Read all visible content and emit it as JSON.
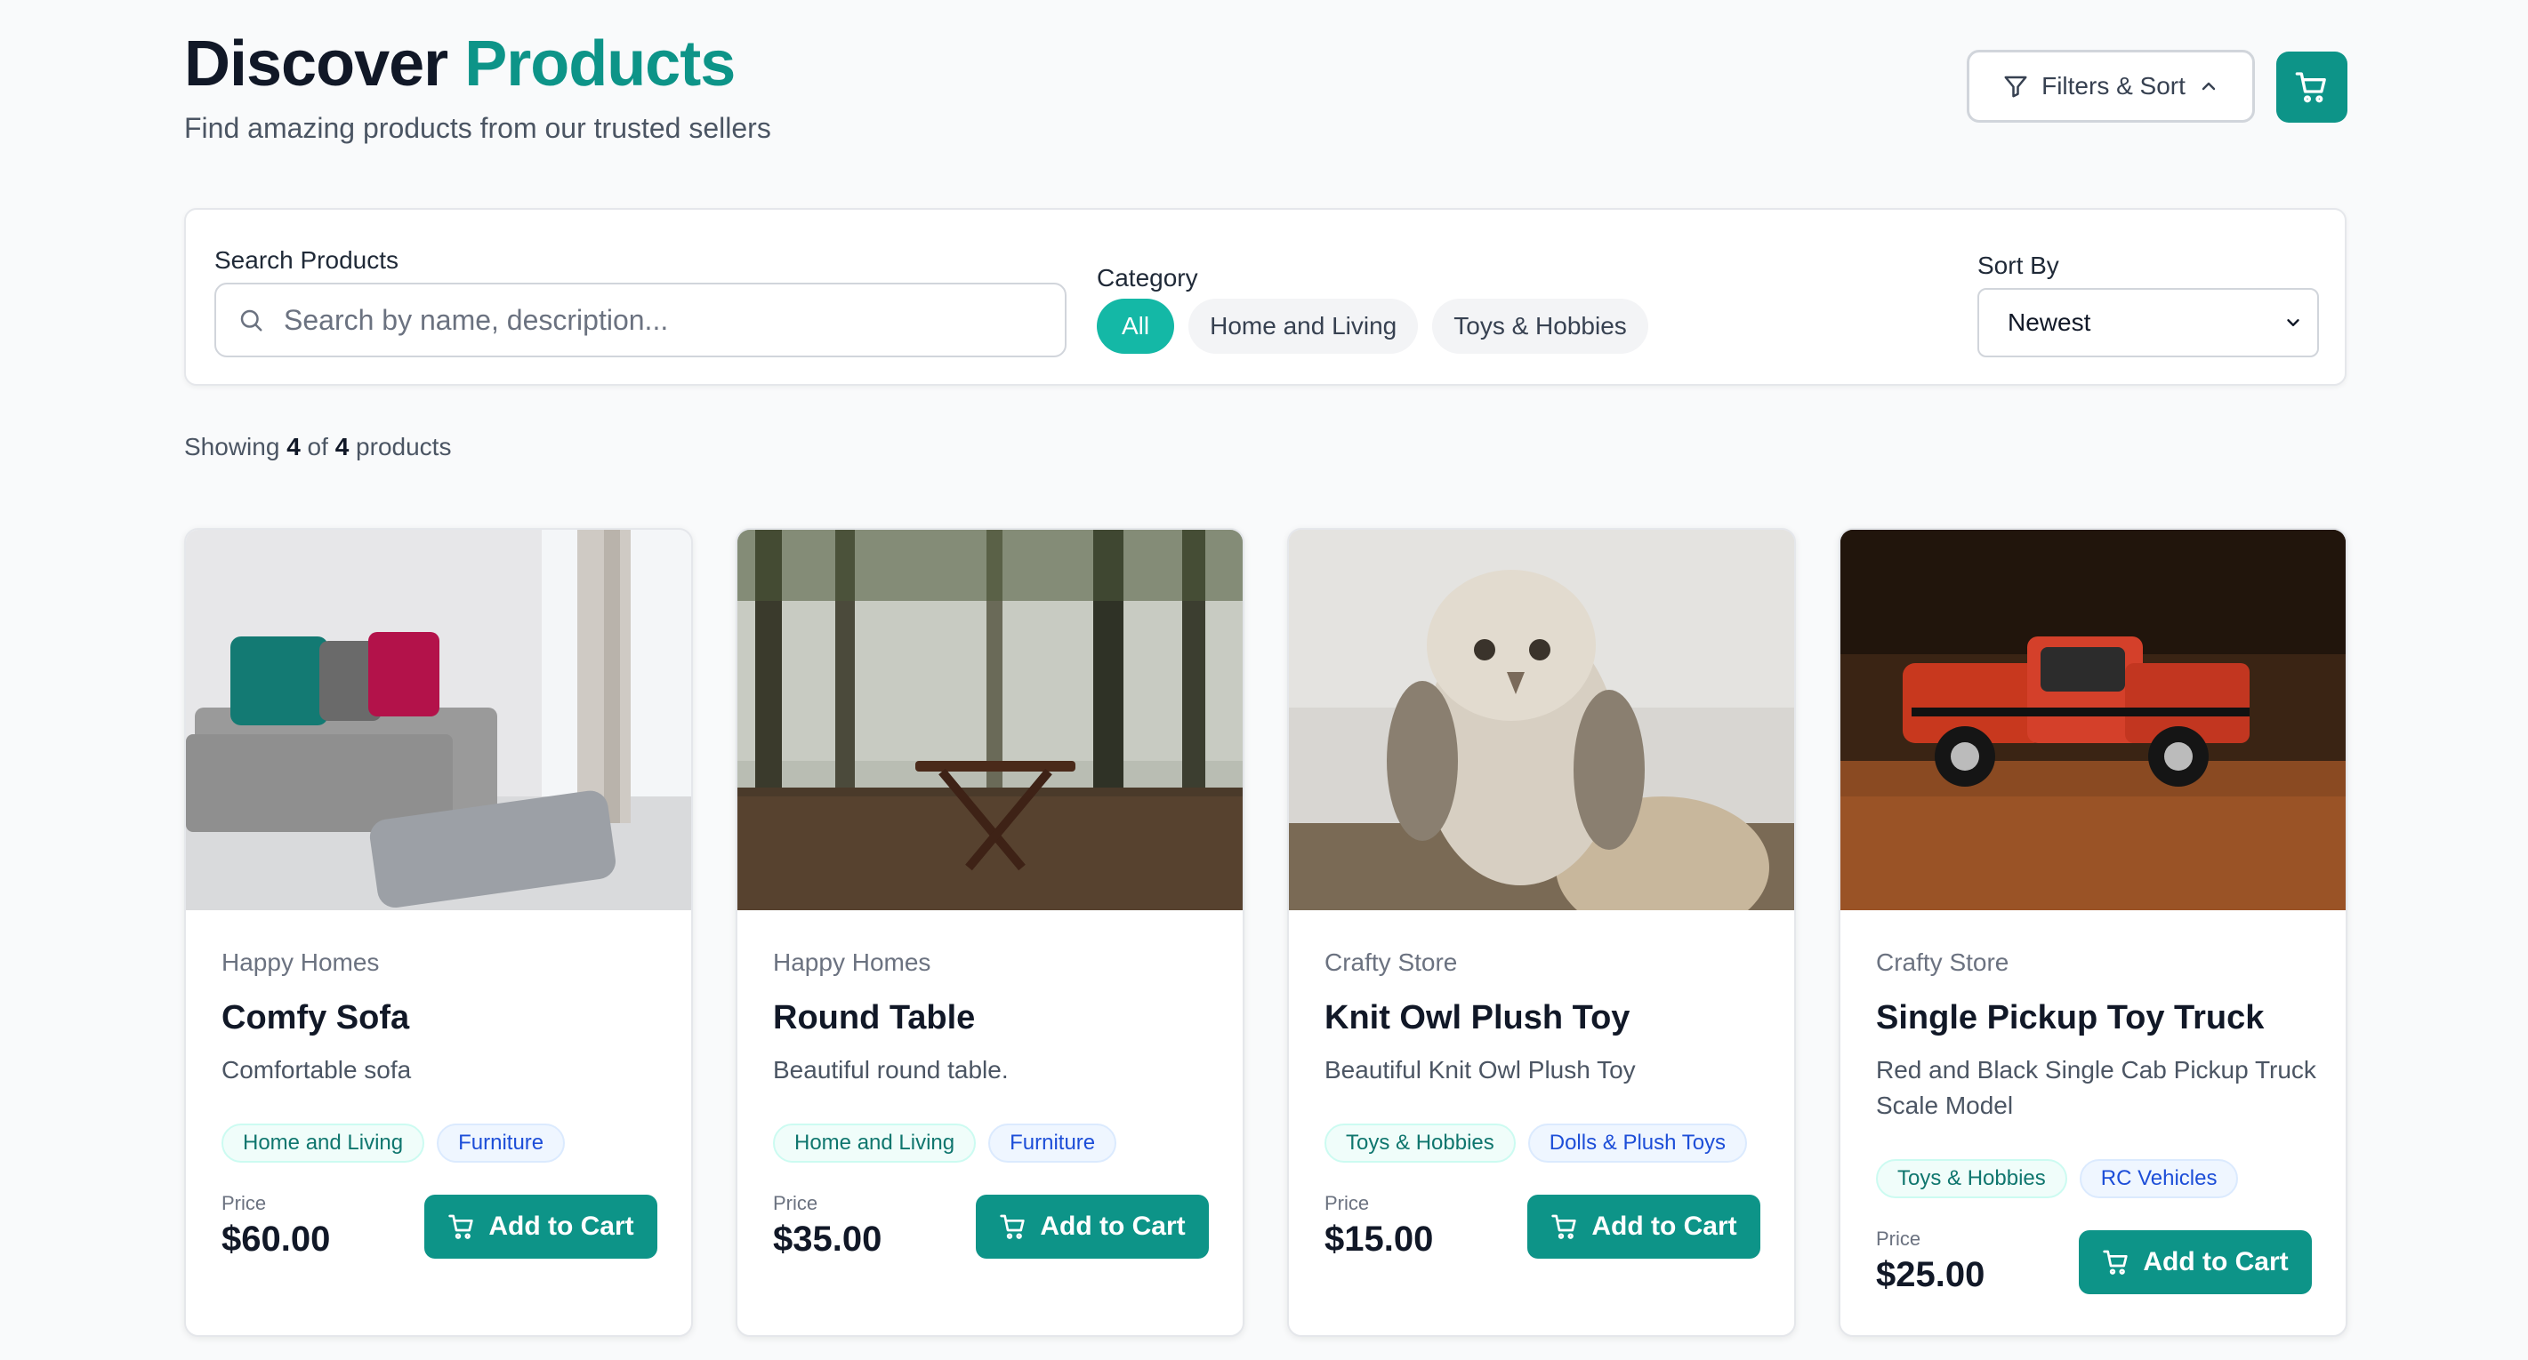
{
  "header": {
    "title_main": "Discover",
    "title_accent": "Products",
    "subtitle": "Find amazing products from our trusted sellers",
    "filters_label": "Filters & Sort"
  },
  "search": {
    "label": "Search Products",
    "placeholder": "Search by name, description...",
    "value": ""
  },
  "category": {
    "label": "Category",
    "options": [
      "All",
      "Home and Living",
      "Toys & Hobbies"
    ],
    "selected": "All"
  },
  "sort": {
    "label": "Sort By",
    "selected": "Newest"
  },
  "results": {
    "prefix": "Showing",
    "shown": "4",
    "of": "of",
    "total": "4",
    "suffix": "products"
  },
  "products": [
    {
      "seller": "Happy Homes",
      "name": "Comfy Sofa",
      "description": "Comfortable sofa",
      "tags": [
        "Home and Living",
        "Furniture"
      ],
      "price_label": "Price",
      "price": "$60.00",
      "button": "Add to Cart"
    },
    {
      "seller": "Happy Homes",
      "name": "Round Table",
      "description": "Beautiful round table.",
      "tags": [
        "Home and Living",
        "Furniture"
      ],
      "price_label": "Price",
      "price": "$35.00",
      "button": "Add to Cart"
    },
    {
      "seller": "Crafty Store",
      "name": "Knit Owl Plush Toy",
      "description": "Beautiful Knit Owl Plush Toy",
      "tags": [
        "Toys & Hobbies",
        "Dolls & Plush Toys"
      ],
      "price_label": "Price",
      "price": "$15.00",
      "button": "Add to Cart"
    },
    {
      "seller": "Crafty Store",
      "name": "Single Pickup Toy Truck",
      "description": "Red and Black Single Cab Pickup Truck Scale Model",
      "tags": [
        "Toys & Hobbies",
        "RC Vehicles"
      ],
      "price_label": "Price",
      "price": "$25.00",
      "button": "Add to Cart"
    }
  ],
  "colors": {
    "accent": "#0d9488",
    "accent_light": "#14b8a6",
    "background": "#f9fafb"
  }
}
